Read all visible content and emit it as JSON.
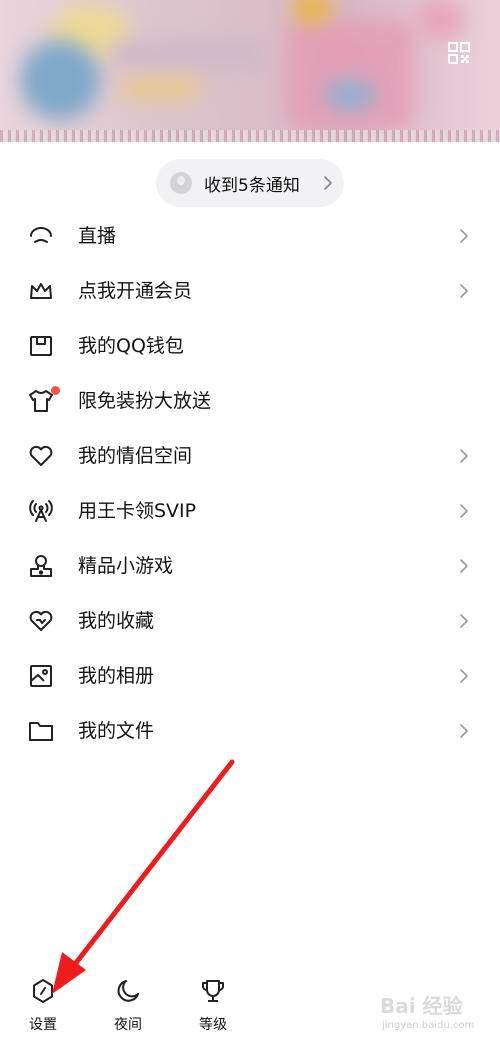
{
  "header": {
    "qr_icon": "qr-code-icon"
  },
  "notification": {
    "text": "收到5条通知",
    "icon": "notification-bell-icon"
  },
  "menu": {
    "items": [
      {
        "label": "直播",
        "icon": "live-icon"
      },
      {
        "label": "点我开通会员",
        "icon": "crown-icon"
      },
      {
        "label": "我的QQ钱包",
        "icon": "wallet-icon"
      },
      {
        "label": "限免装扮大放送",
        "icon": "tshirt-icon",
        "badge": "red-dot"
      },
      {
        "label": "我的情侣空间",
        "icon": "heart-icon"
      },
      {
        "label": "用王卡领SVIP",
        "icon": "signal-tower-icon"
      },
      {
        "label": "精品小游戏",
        "icon": "game-pin-icon"
      },
      {
        "label": "我的收藏",
        "icon": "favorite-heart-icon"
      },
      {
        "label": "我的相册",
        "icon": "photo-album-icon"
      },
      {
        "label": "我的文件",
        "icon": "folder-icon"
      }
    ]
  },
  "bottom_bar": {
    "settings_label": "设置",
    "night_label": "夜间",
    "level_label": "等级"
  },
  "watermark": {
    "brand": "Bai 经验",
    "url": "jingyan.baidu.com"
  },
  "colors": {
    "badge": "#f25543",
    "annotation_arrow": "#ee1c1c"
  }
}
